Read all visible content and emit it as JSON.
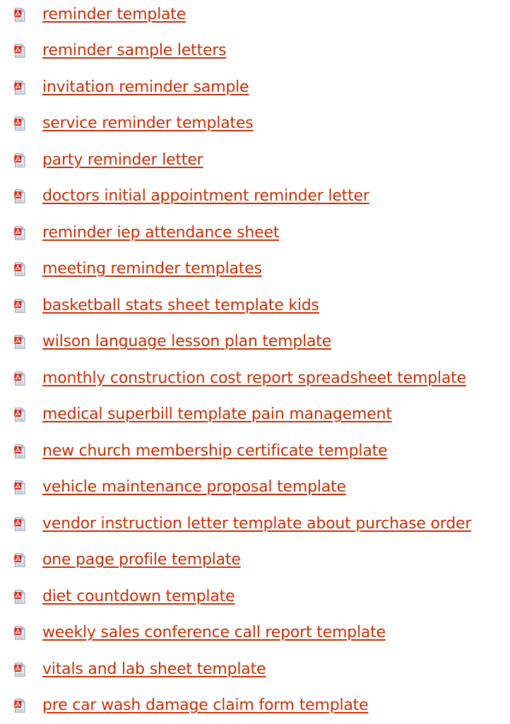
{
  "links": [
    {
      "label": "reminder template",
      "icon": "pdf-file-icon"
    },
    {
      "label": "reminder sample letters",
      "icon": "pdf-file-icon"
    },
    {
      "label": "invitation reminder sample",
      "icon": "pdf-file-icon"
    },
    {
      "label": "service reminder templates",
      "icon": "pdf-file-icon"
    },
    {
      "label": "party reminder letter",
      "icon": "pdf-file-icon"
    },
    {
      "label": "doctors initial appointment reminder letter",
      "icon": "pdf-file-icon"
    },
    {
      "label": "reminder iep attendance sheet",
      "icon": "pdf-file-icon"
    },
    {
      "label": "meeting reminder templates",
      "icon": "pdf-file-icon"
    },
    {
      "label": "basketball stats sheet template kids",
      "icon": "pdf-file-icon"
    },
    {
      "label": "wilson language lesson plan template",
      "icon": "pdf-file-icon"
    },
    {
      "label": "monthly construction cost report spreadsheet template",
      "icon": "pdf-file-icon"
    },
    {
      "label": "medical superbill template pain management",
      "icon": "pdf-file-icon"
    },
    {
      "label": "new church membership certificate template",
      "icon": "pdf-file-icon"
    },
    {
      "label": "vehicle maintenance proposal template",
      "icon": "pdf-file-icon"
    },
    {
      "label": "vendor instruction letter template about purchase order",
      "icon": "pdf-file-icon"
    },
    {
      "label": "one page profile template",
      "icon": "pdf-file-icon"
    },
    {
      "label": "diet countdown template",
      "icon": "pdf-file-icon"
    },
    {
      "label": "weekly sales conference call report template",
      "icon": "pdf-file-icon"
    },
    {
      "label": "vitals and lab sheet template",
      "icon": "pdf-file-icon"
    },
    {
      "label": "pre car wash damage claim form template",
      "icon": "pdf-file-icon"
    }
  ],
  "colors": {
    "link": "#c62b00",
    "icon_red": "#d8261c",
    "icon_page": "#e9eef4"
  }
}
